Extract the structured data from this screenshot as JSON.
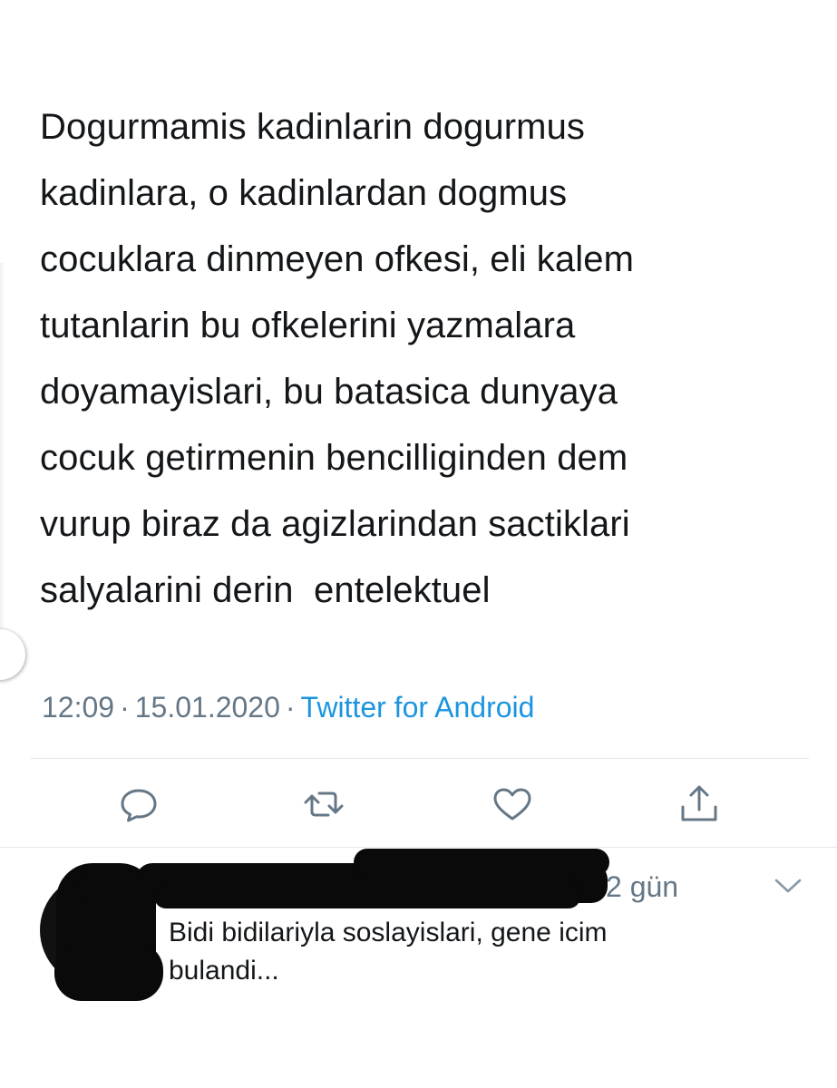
{
  "tweet": {
    "text_lines": [
      "Dogurmamis kadinlarin dogurmus",
      "kadinlara, o kadinlardan dogmus",
      "cocuklara dinmeyen ofkesi, eli kalem",
      "tutanlarin bu ofkelerini yazmalara",
      "doyamayislari, bu batasica dunyaya",
      "cocuk getirmenin bencilliginden dem",
      "vurup biraz da agizlarindan sactiklari",
      "salyalarini derin  entelektuel"
    ],
    "time": "12:09",
    "date": "15.01.2020",
    "separator": "·",
    "source": "Twitter for Android"
  },
  "actions": {
    "reply_icon": "reply-icon",
    "retweet_icon": "retweet-icon",
    "like_icon": "heart-icon",
    "share_icon": "share-icon"
  },
  "reply": {
    "time_ago": "2 gün",
    "text_lines": [
      "Bidi bidilariyla soslayislari, gene icim",
      "bulandi..."
    ]
  },
  "colors": {
    "text": "#14171a",
    "muted": "#657786",
    "link": "#1b95e0",
    "divider": "#e1e8ed"
  }
}
